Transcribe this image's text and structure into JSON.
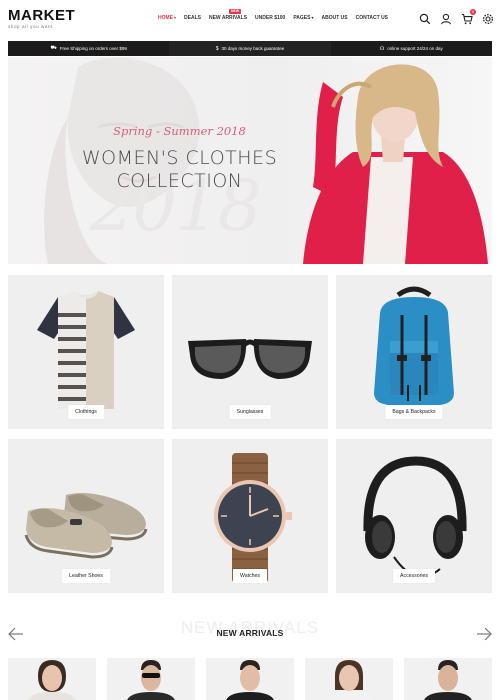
{
  "logo": {
    "name": "MARKET",
    "tagline": "shop all you want"
  },
  "nav": {
    "items": [
      {
        "label": "HOME",
        "caret": "▾",
        "active": true
      },
      {
        "label": "DEALS"
      },
      {
        "label": "NEW ARRIVALS",
        "badge": "NEW"
      },
      {
        "label": "UNDER $100"
      },
      {
        "label": "PAGES",
        "caret": "▾"
      },
      {
        "label": "ABOUT US"
      },
      {
        "label": "CONTACT US"
      }
    ]
  },
  "header_icons": {
    "search": "search-icon",
    "account": "user-icon",
    "cart": "cart-icon",
    "cart_count": "0",
    "settings": "gear-icon"
  },
  "infobar": {
    "shipping": "Free Shipping on orders over $99",
    "guarantee": "30 days money back guarantee",
    "support": "online support 24/24 on day"
  },
  "hero": {
    "script": "Spring - Summer 2018",
    "title_line1": "WOMEN'S CLOTHES",
    "title_line2": "COLLECTION",
    "ghost_year": "2018"
  },
  "categories": [
    {
      "label": "Clothings"
    },
    {
      "label": "Sunglasses"
    },
    {
      "label": "Bags & Backpacks"
    },
    {
      "label": "Leather Shoes"
    },
    {
      "label": "Watches"
    },
    {
      "label": "Accessories"
    }
  ],
  "new_arrivals": {
    "ghost": "NEW ARRIVALS",
    "title": "NEW ARRIVALS",
    "prev": "‹",
    "next": "›"
  },
  "colors": {
    "accent": "#e5384a",
    "hero_script": "#d65e7c",
    "jacket": "#e1204a",
    "backpack": "#2b8fc6"
  }
}
